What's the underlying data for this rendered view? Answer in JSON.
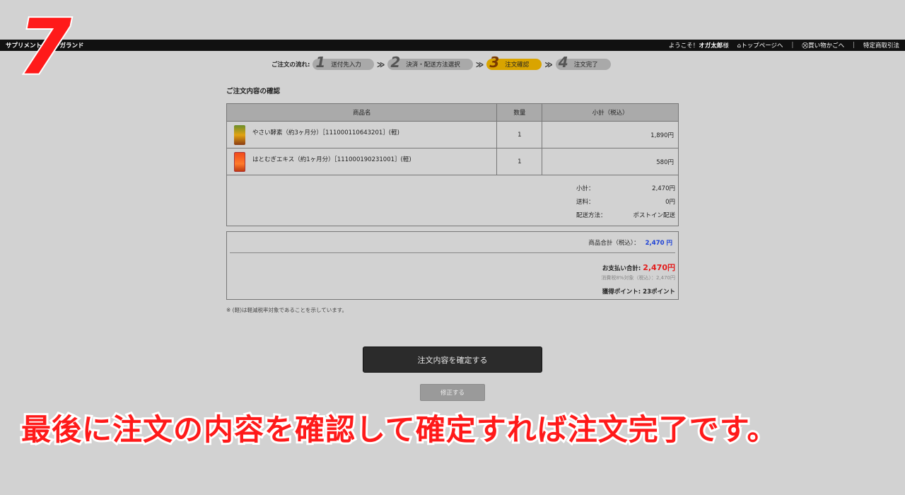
{
  "step_overlay": "7",
  "topbar": {
    "site_name": "サプリメント・ガーガランド",
    "welcome": "ようこそ！",
    "user_name": "オガ太郎",
    "honorific": "様",
    "top_page": "トップページへ",
    "cart": "買い物かごへ",
    "legal": "特定商取引法"
  },
  "flow": {
    "label": "ご注文の流れ:",
    "steps": [
      {
        "num": "1",
        "label": "送付先入力"
      },
      {
        "num": "2",
        "label": "決済・配送方法選択"
      },
      {
        "num": "3",
        "label": "注文確認"
      },
      {
        "num": "4",
        "label": "注文完了"
      }
    ],
    "arrow": "≫"
  },
  "section_title": "ご注文内容の確認",
  "table": {
    "headers": [
      "商品名",
      "数量",
      "小計（税込）"
    ],
    "rows": [
      {
        "name": "やさい酵素（約3ヶ月分）［111000110643201］(軽)",
        "qty": "1",
        "subtotal": "1,890円"
      },
      {
        "name": "はとむぎエキス（約1ヶ月分）［111000190231001］(軽)",
        "qty": "1",
        "subtotal": "580円"
      }
    ]
  },
  "totals": {
    "subtotal_label": "小計：",
    "subtotal_value": "2,470円",
    "shipping_label": "送料：",
    "shipping_value": "0円",
    "method_label": "配送方法：",
    "method_value": "ポストイン配送"
  },
  "summary": {
    "goods_label": "商品合計（税込）：",
    "goods_value": "2,470 円",
    "pay_label": "お支払い合計:",
    "pay_value": "2,470円",
    "tax_note": "消費税8%対象（税込）：2,470円",
    "points_label": "獲得ポイント: 23ポイント"
  },
  "note": "※ (軽)は軽減税率対象であることを示しています。",
  "buttons": {
    "confirm": "注文内容を確定する",
    "fix": "修正する"
  },
  "caption": "最後に注文の内容を確認して確定すれば注文完了です。",
  "colors": {
    "accent_red": "#ff1a1a",
    "active_step": "#d9a400",
    "goods_total_blue": "#1a3fd6"
  }
}
